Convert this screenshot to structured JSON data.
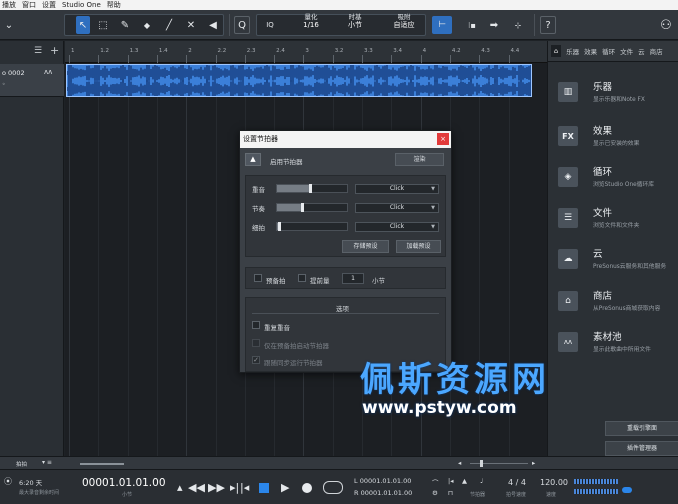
{
  "menubar": {
    "items": [
      "播放",
      "窗口",
      "设置",
      "Studio One",
      "帮助"
    ]
  },
  "toolbar": {
    "tools": [
      {
        "name": "arrow-tool-icon",
        "glyph": "↖"
      },
      {
        "name": "range-tool-icon",
        "glyph": "⬚"
      },
      {
        "name": "paint-tool-icon",
        "glyph": "✎"
      },
      {
        "name": "eraser-tool-icon",
        "glyph": "◆"
      },
      {
        "name": "line-tool-icon",
        "glyph": "╱"
      },
      {
        "name": "mute-tool-icon",
        "glyph": "✕"
      },
      {
        "name": "split-tool-icon",
        "glyph": "◢"
      },
      {
        "name": "listen-tool-icon",
        "glyph": "◀"
      }
    ],
    "zoom_icon": "Q",
    "iq_label": "IQ",
    "quantize": {
      "label": "量化",
      "value": "1/16"
    },
    "timebase": {
      "label": "时基",
      "value": "小节"
    },
    "snap": {
      "label": "吸附",
      "value": "自适应"
    }
  },
  "track": {
    "name": "o 0002",
    "label": "ᴧᴧ"
  },
  "ruler": {
    "marks": [
      "1",
      "1.2",
      "1.3",
      "1.4",
      "2",
      "2.2",
      "2.3",
      "2.4",
      "3",
      "3.2",
      "3.3",
      "3.4",
      "4",
      "4.2",
      "4.3",
      "4.4"
    ]
  },
  "browser": {
    "tabs": [
      "乐器",
      "效果",
      "循环",
      "文件",
      "云",
      "商店"
    ],
    "items": [
      {
        "icon": "piano-icon",
        "glyph": "▥",
        "title": "乐器",
        "sub": "显示乐器和Note FX"
      },
      {
        "icon": "fx-icon",
        "glyph": "FX",
        "title": "效果",
        "sub": "显示已安装的效果"
      },
      {
        "icon": "loop-icon",
        "glyph": "◈",
        "title": "循环",
        "sub": "浏览Studio One循环库"
      },
      {
        "icon": "file-icon",
        "glyph": "☰",
        "title": "文件",
        "sub": "浏览文件和文件夹"
      },
      {
        "icon": "cloud-icon",
        "glyph": "☁",
        "title": "云",
        "sub": "PreSonus云服务和其他服务"
      },
      {
        "icon": "shop-icon",
        "glyph": "⌂",
        "title": "商店",
        "sub": "从PreSonus商城获取内容"
      },
      {
        "icon": "pool-icon",
        "glyph": "ᴧᴧ",
        "title": "素材池",
        "sub": "显示此歌曲中所用文件"
      }
    ],
    "btn1": "重载引擎面",
    "btn2": "插件管理器"
  },
  "dialog": {
    "title": "设置节拍器",
    "enable": "启用节拍器",
    "render": "渲染",
    "rows": [
      {
        "label": "重音",
        "value": "Click",
        "level": 0.47
      },
      {
        "label": "节奏",
        "value": "Click",
        "level": 0.35
      },
      {
        "label": "细拍",
        "value": "Click",
        "level": 0.03
      }
    ],
    "save_preset": "存储预设",
    "load_preset": "加载预设",
    "precount": "预备拍",
    "preroll": "提前量",
    "bars_value": "1",
    "bars_unit": "小节",
    "options": "选项",
    "opt1": "重复重音",
    "opt2": "仅在预备拍启动节拍器",
    "opt3": "跟随同步运行节拍器"
  },
  "transport": {
    "timeline_label": "拍拍",
    "time": "6:20 天",
    "time_sub": "最大录音剩余时间",
    "position": "00001.01.01.00",
    "position_sub": "小节",
    "loop_start": "L  00001.01.01.00",
    "loop_end": "R  00001.01.01.00",
    "signature": "4 / 4",
    "signature_sub": "拍号速度",
    "tempo": "120.00",
    "tempo_sub": "速度",
    "metronome_sub": "节拍器"
  },
  "watermark": {
    "cn": "佩斯资源网",
    "url": "www.pstyw.com"
  },
  "colors": {
    "clip": "#3b7fd8",
    "accent": "#2f6fbf",
    "close": "#e23a3a"
  }
}
